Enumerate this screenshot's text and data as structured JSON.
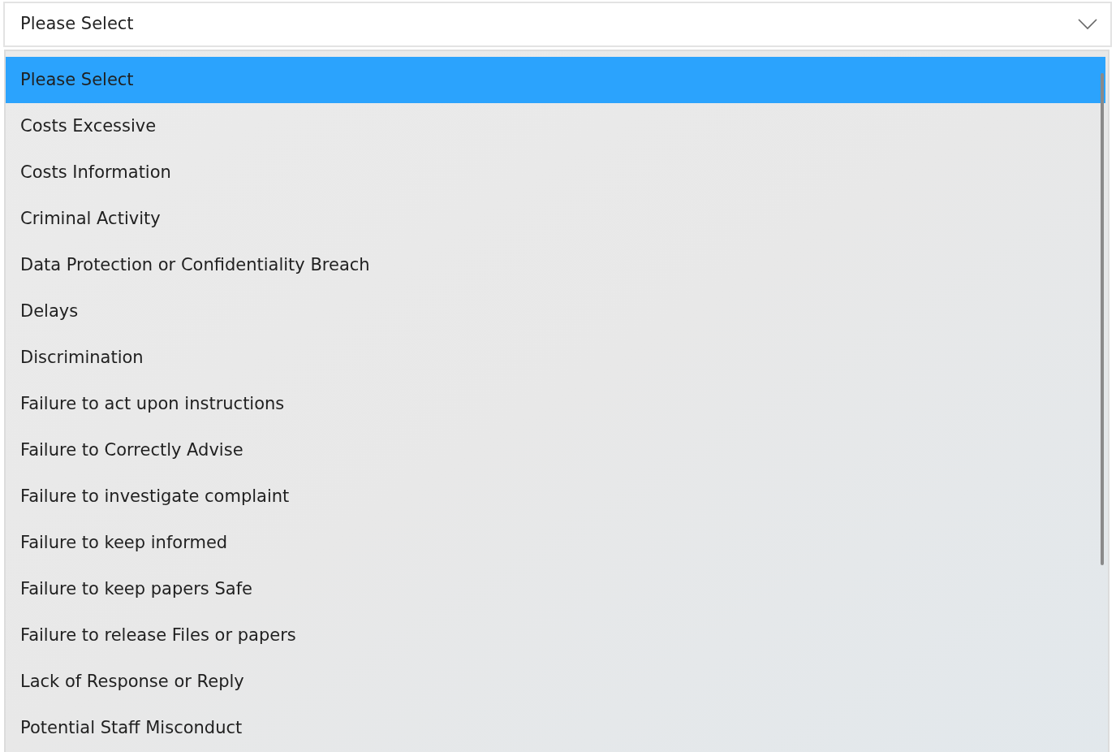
{
  "select": {
    "value": "Please Select"
  },
  "options": [
    {
      "label": "Please Select",
      "selected": true
    },
    {
      "label": "Costs Excessive",
      "selected": false
    },
    {
      "label": "Costs Information",
      "selected": false
    },
    {
      "label": "Criminal Activity",
      "selected": false
    },
    {
      "label": "Data Protection or Confidentiality Breach",
      "selected": false
    },
    {
      "label": "Delays",
      "selected": false
    },
    {
      "label": "Discrimination",
      "selected": false
    },
    {
      "label": "Failure to act upon instructions",
      "selected": false
    },
    {
      "label": "Failure to Correctly Advise",
      "selected": false
    },
    {
      "label": "Failure to investigate complaint",
      "selected": false
    },
    {
      "label": "Failure to keep informed",
      "selected": false
    },
    {
      "label": "Failure to keep papers Safe",
      "selected": false
    },
    {
      "label": "Failure to release Files or papers",
      "selected": false
    },
    {
      "label": "Lack of Response or Reply",
      "selected": false
    },
    {
      "label": "Potential Staff Misconduct",
      "selected": false
    }
  ]
}
